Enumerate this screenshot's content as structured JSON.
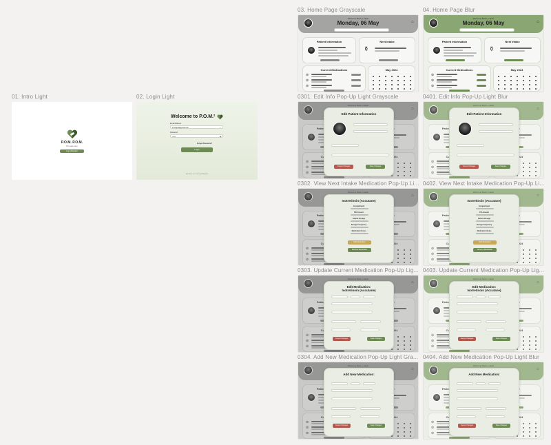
{
  "frames": {
    "intro": {
      "label": "01. Intro Light",
      "logo_text": "P.O.M. P.O.M.",
      "tagline": "RX made easy",
      "button": "Log in/Register"
    },
    "login": {
      "label": "02. Login Light",
      "title": "Welcome to P.O.M.²",
      "email_label": "Email Address",
      "email_value": "lucasgutt@gmail.com",
      "password_label": "Password",
      "password_value": "••••••",
      "forgot": "Forgot Password?",
      "login_button": "Login",
      "footer": "Don't have an account yet? Register"
    },
    "home_gray": {
      "label": "03. Home Page Grayscale"
    },
    "home_blur": {
      "label": "04. Home Page Blur"
    },
    "edit_info_gray": {
      "label": "0301. Edit Info Pop-Up Light Grayscale"
    },
    "edit_info_blur": {
      "label": "0401. Edit Info Pop-Up Light Blur"
    },
    "next_intake_gray": {
      "label": "0302. View Next Intake Medication Pop-Up Li..."
    },
    "next_intake_blur": {
      "label": "0402. View Next Intake Medication Pop-Up Li..."
    },
    "update_med_gray": {
      "label": "0303. Update Current Medication Pop-Up Lig..."
    },
    "update_med_blur": {
      "label": "0403. Update Current Medication Pop-Up Lig..."
    },
    "add_med_gray": {
      "label": "0304. Add New Medication Pop-Up Light Gra..."
    },
    "add_med_blur": {
      "label": "0404. Add New Medication Pop-Up Light Blur"
    }
  },
  "home": {
    "welcome": "Welcome Back, Lukas!",
    "date": "Monday, 06 May",
    "search_placeholder": "Search medication name",
    "patient_info_title": "Patient Information",
    "patient_name": "Lukas Guillo Adolfo Ganes",
    "next_intake_title": "Next Intake",
    "next_intake_med": "Isotretinoin (Accutane)",
    "current_meds_title": "Current Medications",
    "calendar_month": "May 2024"
  },
  "popups": {
    "edit_info_title": "Edit Patient Information",
    "next_intake_title": "Isotretinoin (Accutane)",
    "next_intake_fields": [
      "Compartment",
      "Pill Amount",
      "Patient Dosage",
      "Dosage Frequency",
      "Medication Notes"
    ],
    "update_title_1": "Edit Medication:",
    "update_title_2": "Isotretinoin (Accutane)",
    "add_title": "Add New Medication:",
    "save_button": "Save Changes",
    "cancel_button": "Cancel Changes",
    "edit_med_button": "Edit Medication",
    "remove_med_button": "Remove Medication"
  },
  "colors": {
    "gray_header": "#a4a4a2",
    "green_header": "#8aa673",
    "accent_green": "#6e8b55",
    "danger_red": "#b3584f",
    "gold": "#c9a75a"
  }
}
